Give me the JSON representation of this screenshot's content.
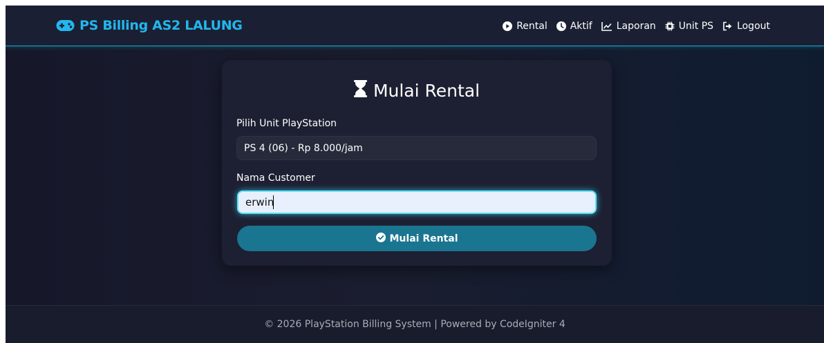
{
  "navbar": {
    "brand_icon": "gamepad-icon",
    "brand": "PS Billing AS2 LALUNG",
    "items": [
      {
        "label": "Rental",
        "icon": "play-circle-icon"
      },
      {
        "label": "Aktif",
        "icon": "clock-icon"
      },
      {
        "label": "Laporan",
        "icon": "chart-line-icon"
      },
      {
        "label": "Unit PS",
        "icon": "chip-icon"
      },
      {
        "label": "Logout",
        "icon": "logout-icon"
      }
    ]
  },
  "form": {
    "title_icon": "hourglass-icon",
    "title": "Mulai Rental",
    "unit_label": "Pilih Unit PlayStation",
    "unit_selected": "PS 4 (06) - Rp 8.000/jam",
    "customer_label": "Nama Customer",
    "customer_value": "erwin",
    "submit_icon": "check-circle-icon",
    "submit_label": "Mulai Rental"
  },
  "footer": {
    "text": "© 2026 PlayStation Billing System | Powered by CodeIgniter 4"
  },
  "colors": {
    "brand": "#22b7ee",
    "button": "#1a7591",
    "input_glow": "#5fe1f4",
    "card": "#1d2032"
  }
}
